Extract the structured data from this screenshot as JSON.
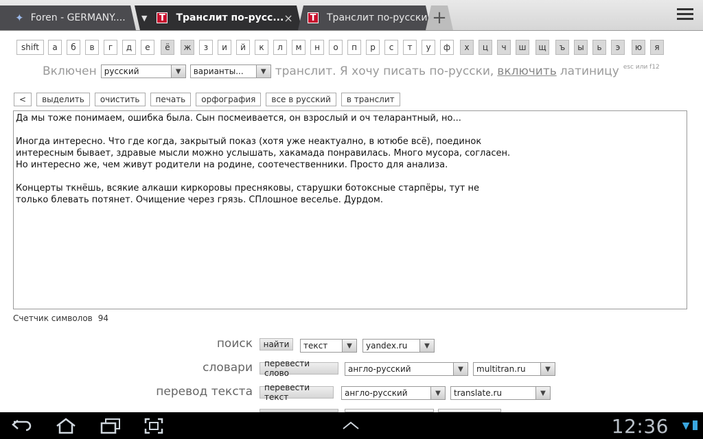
{
  "tabs": {
    "tab1": {
      "title": "Foren - GERMANY...."
    },
    "tab2": {
      "title": "Транслит по-русс..."
    },
    "tab3": {
      "title": "Транслит по-русски"
    },
    "new_tab_glyph": "+",
    "close_glyph": "×",
    "caret_glyph": "▼",
    "favicon_letter": "T"
  },
  "keyboard": {
    "shift": "shift",
    "letters": [
      "а",
      "б",
      "в",
      "г",
      "д",
      "е",
      "ё",
      "ж",
      "з",
      "и",
      "й",
      "к",
      "л",
      "м",
      "н",
      "о",
      "п",
      "р",
      "с",
      "т",
      "у",
      "ф",
      "х",
      "ц",
      "ч",
      "ш",
      "щ",
      "ъ",
      "ы",
      "ь",
      "э",
      "ю",
      "я"
    ]
  },
  "mode": {
    "prefix": "Включен",
    "language_select": "русский",
    "variants_select": "варианты...",
    "middle_text": "транслит. Я хочу писать по-русски,",
    "link": "включить",
    "suffix": "латиницу",
    "hint": "esc или f12"
  },
  "actions": [
    "<",
    "выделить",
    "очистить",
    "печать",
    "орфография",
    "все в русский",
    "в транслит"
  ],
  "editor": {
    "text": "Да мы тоже понимаем, ошибка была. Сын посмеивается, он взрослый и оч теларантный, но...\n\nИногда интересно. Что где когда, закрытый показ (хотя уже неактуално, в ютюбе всё), поединок\nинтересным бывает, здравые мысли можно услышать, хакамада понравилась. Много мусора, согласен.\nНо интересно же, чем живут родители на родине, соотечественники. Просто для анализа.\n\nКонцерты ткнёшь, всякие алкаши киркоровы пресняковы, старушки ботоксные старпёры, тут не\nтолько блевать потянет. Очищение через грязь. СПлошное веселье. Дурдом."
  },
  "counter": {
    "label": "Счетчик символов",
    "value": "94"
  },
  "tools": {
    "search": {
      "label": "поиск",
      "button": "найти",
      "type": "текст",
      "engine": "yandex.ru"
    },
    "dict": {
      "label": "словари",
      "button": "перевести слово",
      "direction": "англо-русский",
      "site": "multitran.ru"
    },
    "translate": {
      "label": "перевод текста",
      "button": "перевести текст",
      "direction": "англо-русский",
      "site": "translate.ru"
    }
  },
  "statusbar": {
    "time": "12:36"
  },
  "colors": {
    "favicon_red": "#c8102e",
    "status_blue": "#3aa7e0"
  }
}
